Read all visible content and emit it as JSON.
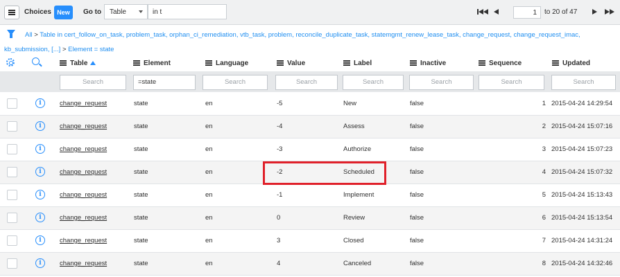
{
  "toolbar": {
    "choices_label": "Choices",
    "new_label": "New",
    "goto_label": "Go to",
    "goto_field": "Table",
    "goto_value": "in t",
    "page_current": "1",
    "page_info": "to 20 of 47"
  },
  "breadcrumb": {
    "line1_all": "All",
    "line1_rest": "Table in cert_follow_on_task, problem_task, orphan_ci_remediation, vtb_task, problem, reconcile_duplicate_task, statemgmt_renew_lease_task, change_request, change_request_imac,",
    "line2_rest": "kb_submission, [...]",
    "line2_cond": "Element = state",
    "sep": ">"
  },
  "columns": [
    "Table",
    "Element",
    "Language",
    "Value",
    "Label",
    "Inactive",
    "Sequence",
    "Updated"
  ],
  "search": {
    "placeholder": "Search",
    "element_value": "=state"
  },
  "rows": [
    {
      "table": "change_request",
      "element": "state",
      "language": "en",
      "value": "-5",
      "label": "New",
      "inactive": "false",
      "sequence": "1",
      "updated": "2015-04-24 14:29:54"
    },
    {
      "table": "change_request",
      "element": "state",
      "language": "en",
      "value": "-4",
      "label": "Assess",
      "inactive": "false",
      "sequence": "2",
      "updated": "2015-04-24 15:07:16"
    },
    {
      "table": "change_request",
      "element": "state",
      "language": "en",
      "value": "-3",
      "label": "Authorize",
      "inactive": "false",
      "sequence": "3",
      "updated": "2015-04-24 15:07:23"
    },
    {
      "table": "change_request",
      "element": "state",
      "language": "en",
      "value": "-2",
      "label": "Scheduled",
      "inactive": "false",
      "sequence": "4",
      "updated": "2015-04-24 15:07:32"
    },
    {
      "table": "change_request",
      "element": "state",
      "language": "en",
      "value": "-1",
      "label": "Implement",
      "inactive": "false",
      "sequence": "5",
      "updated": "2015-04-24 15:13:43"
    },
    {
      "table": "change_request",
      "element": "state",
      "language": "en",
      "value": "0",
      "label": "Review",
      "inactive": "false",
      "sequence": "6",
      "updated": "2015-04-24 15:13:54"
    },
    {
      "table": "change_request",
      "element": "state",
      "language": "en",
      "value": "3",
      "label": "Closed",
      "inactive": "false",
      "sequence": "7",
      "updated": "2015-04-24 14:31:24"
    },
    {
      "table": "change_request",
      "element": "state",
      "language": "en",
      "value": "4",
      "label": "Canceled",
      "inactive": "false",
      "sequence": "8",
      "updated": "2015-04-24 14:32:46"
    }
  ],
  "colors": {
    "accent": "#278efc",
    "highlight": "#e0202a"
  }
}
